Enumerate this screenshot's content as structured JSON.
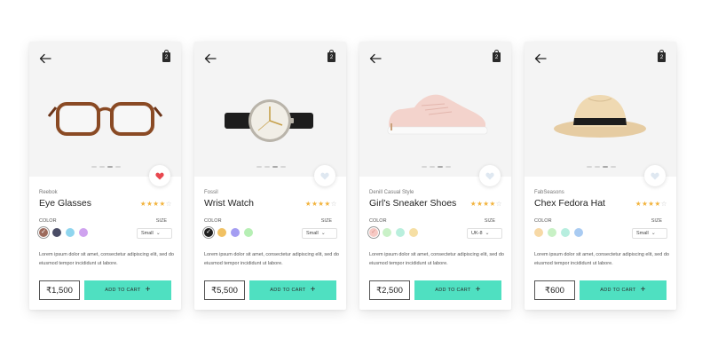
{
  "labels": {
    "color": "COLOR",
    "size": "SIZE",
    "add_to_cart": "ADD TO CART",
    "plus": "+",
    "bag_count": "2"
  },
  "description": "Lorem ipsum dolor sit amet, consectetur adipiscing elit, sed do eiusmod tempor incididunt ut labore.",
  "accent": "#4fe0c1",
  "star_color": "#f2b33d",
  "cards": [
    {
      "brand": "Reebok",
      "title": "Eye Glasses",
      "rating": 4,
      "rating_max": 5,
      "price": "₹1,500",
      "size": "Small",
      "favorited": true,
      "swatches": [
        "#9c6a5c",
        "#4a4d66",
        "#8fd5ee",
        "#cfa2ef"
      ],
      "selected_swatch": 0
    },
    {
      "brand": "Fossil",
      "title": "Wrist Watch",
      "rating": 4,
      "rating_max": 5,
      "price": "₹5,500",
      "size": "Small",
      "favorited": false,
      "swatches": [
        "#1f1f1f",
        "#f1c163",
        "#a49df2",
        "#b6efb4"
      ],
      "selected_swatch": 0
    },
    {
      "brand": "Denill Casual Style",
      "title": "Girl's Sneaker Shoes",
      "rating": 4,
      "rating_max": 5,
      "price": "₹2,500",
      "size": "UK-8",
      "favorited": false,
      "swatches": [
        "#f6c9c4",
        "#c9f1c7",
        "#b9efdd",
        "#f6dfa4"
      ],
      "selected_swatch": 0
    },
    {
      "brand": "FabSeasons",
      "title": "Chex Fedora Hat",
      "rating": 4,
      "rating_max": 5,
      "price": "₹600",
      "size": "Small",
      "favorited": false,
      "swatches": [
        "#f7d9a6",
        "#c8f1c5",
        "#b7eedf",
        "#a9cbf2"
      ],
      "selected_swatch": -1
    }
  ]
}
